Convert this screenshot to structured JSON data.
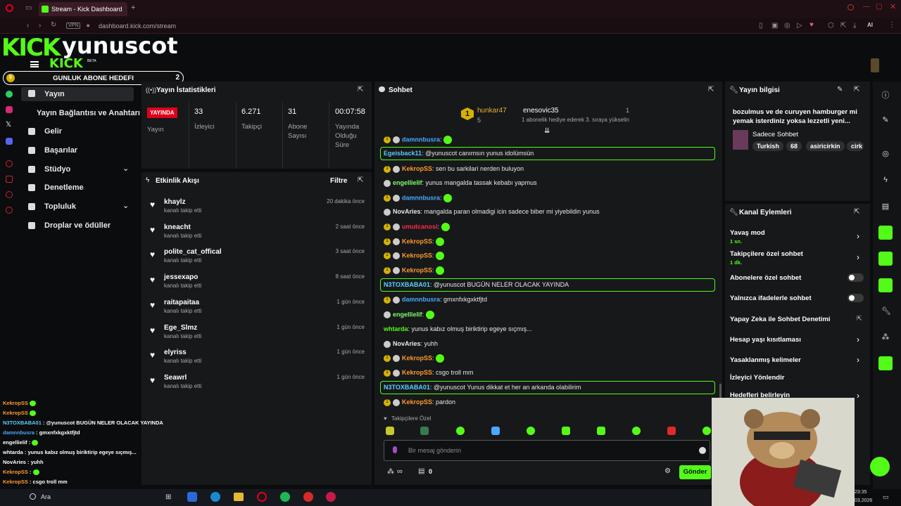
{
  "browser": {
    "tab_title": "Stream - Kick Dashboard",
    "new_tab": "+",
    "url": "dashboard.kick.com/stream",
    "vpn": "VPN",
    "ai": "AI"
  },
  "brand": {
    "logo": "KICK",
    "logo_small": "KICK",
    "beta": "BETA",
    "channel": "yunuscot",
    "goal_label": "GUNLUK ABONE HEDEFI",
    "goal_left": "0",
    "goal_right": "2"
  },
  "sidebar": {
    "items": [
      {
        "label": "Yayın",
        "icon": "video-icon"
      },
      {
        "label": "Yayın Bağlantısı ve Anahtarı",
        "icon": ""
      },
      {
        "label": "Gelir",
        "icon": "dollar-icon"
      },
      {
        "label": "Başarılar",
        "icon": "trophy-icon"
      },
      {
        "label": "Stüdyo",
        "icon": "studio-icon"
      },
      {
        "label": "Denetleme",
        "icon": "wrench-icon"
      },
      {
        "label": "Topluluk",
        "icon": "community-icon"
      },
      {
        "label": "Droplar ve ödüller",
        "icon": "gift-icon"
      }
    ]
  },
  "stats": {
    "title": "Yayın İstatistikleri",
    "live": "YAYINDA",
    "live_label": "Yayın",
    "viewers": "33",
    "viewers_label": "İzleyici",
    "followers": "6.271",
    "followers_label": "Takipçi",
    "subs": "31",
    "subs_label_1": "Abone",
    "subs_label_2": "Sayısı",
    "uptime": "00:07:58",
    "uptime_label_1": "Yayında",
    "uptime_label_2": "Olduğu",
    "uptime_label_3": "Süre"
  },
  "activity": {
    "title": "Etkinlik Akışı",
    "filter": "Filtre",
    "rows": [
      {
        "name": "khaylz",
        "sub": "kanalı takip etti",
        "time": "20 dakika önce"
      },
      {
        "name": "kneacht",
        "sub": "kanalı takip etti",
        "time": "2 saat önce"
      },
      {
        "name": "polite_cat_offical",
        "sub": "kanalı takip etti",
        "time": "3 saat önce"
      },
      {
        "name": "jessexapo",
        "sub": "kanalı takip etti",
        "time": "8 saat önce"
      },
      {
        "name": "raitapaitaa",
        "sub": "kanalı takip etti",
        "time": "1 gün önce"
      },
      {
        "name": "Ege_Slmz",
        "sub": "kanalı takip etti",
        "time": "1 gün önce"
      },
      {
        "name": "elyriss",
        "sub": "kanalı takip etti",
        "time": "1 gün önce"
      },
      {
        "name": "Seawrl",
        "sub": "kanalı takip etti",
        "time": "1 gün önce"
      }
    ]
  },
  "chat": {
    "title": "Sohbet",
    "pinned_user1": "hunkar47",
    "pinned_count1": "5",
    "pinned_rank": "1",
    "pinned_user2": "enesovic35",
    "pinned_count2": "1",
    "pinned_text": "1 abonelik hediye ederek 3. sıraya yükselin",
    "messages": [
      {
        "user": "damnnbusra",
        "text": "",
        "color": "#4aa8ff",
        "boxed": false,
        "badges": 2
      },
      {
        "user": "Egeisback11",
        "text": "@yunuscot canımsın yunus idolümsün",
        "color": "#5cc9ff",
        "boxed": true,
        "badges": 0
      },
      {
        "user": "KekropSS",
        "text": "sen bu sarkilari nerden buluyon",
        "color": "#ff9a2e",
        "boxed": false,
        "badges": 2
      },
      {
        "user": "engellielif",
        "text": "yunus mangalda tassak kebabı yapmus",
        "color": "#7dff6b",
        "boxed": false,
        "badges": 1
      },
      {
        "user": "damnnbusra",
        "text": "",
        "color": "#4aa8ff",
        "boxed": false,
        "badges": 2
      },
      {
        "user": "NovAries",
        "text": "mangalda paran olmadigi icin sadece biber mi yiyebildin yunus",
        "color": "#e8e8e8",
        "boxed": false,
        "badges": 1
      },
      {
        "user": "umutcanosi",
        "text": "",
        "color": "#ff2a4a",
        "boxed": false,
        "badges": 2
      },
      {
        "user": "KekropSS",
        "text": "",
        "color": "#ff9a2e",
        "boxed": false,
        "badges": 2
      },
      {
        "user": "KekropSS",
        "text": "",
        "color": "#ff9a2e",
        "boxed": false,
        "badges": 2
      },
      {
        "user": "KekropSS",
        "text": "",
        "color": "#ff9a2e",
        "boxed": false,
        "badges": 2
      },
      {
        "user": "N3TOXBABA01",
        "text": "@yunuscot BUGÜN NELER OLACAK YAYINDA",
        "color": "#5cd0ff",
        "boxed": true,
        "badges": 0
      },
      {
        "user": "damnnbusra",
        "text": "gmxnfxkgxktfjtd",
        "color": "#4aa8ff",
        "boxed": false,
        "badges": 2
      },
      {
        "user": "engellielif",
        "text": "",
        "color": "#7dff6b",
        "boxed": false,
        "badges": 1
      },
      {
        "user": "whtarda",
        "text": "yunus kabız olmuş biriktirip egeye sıçmış...",
        "color": "#53fc18",
        "boxed": false,
        "badges": 0
      },
      {
        "user": "NovAries",
        "text": "yuhh",
        "color": "#e8e8e8",
        "boxed": false,
        "badges": 1
      },
      {
        "user": "KekropSS",
        "text": "",
        "color": "#ff9a2e",
        "boxed": false,
        "badges": 2
      },
      {
        "user": "KekropSS",
        "text": "csgo troll mm",
        "color": "#ff9a2e",
        "boxed": false,
        "badges": 2
      },
      {
        "user": "N3TOXBABA01",
        "text": "@yunuscot Yunus dikkat et her an arkanda olabilirim",
        "color": "#5cd0ff",
        "boxed": true,
        "badges": 0
      },
      {
        "user": "KekropSS",
        "text": "pardon",
        "color": "#ff9a2e",
        "boxed": false,
        "badges": 2
      }
    ],
    "follower_only": "Takipçilere Özel",
    "input_placeholder": "Bir mesaj gönderin",
    "send": "Gönder",
    "counter": "0"
  },
  "stream_info": {
    "title": "Yayın bilgisi",
    "description": "bozulmus ve de curuyen hamburger mi yemak isterdiniz yoksa lezzetli yeni...",
    "category": "Sadece Sohbet",
    "tags": [
      "Turkish",
      "68",
      "asiricirkin",
      "cirk"
    ]
  },
  "channel_actions": {
    "title": "Kanal Eylemleri",
    "slow_mode": "Yavaş mod",
    "slow_mode_val": "1 sn.",
    "followers_chat": "Takipçilere özel sohbet",
    "followers_chat_val": "1 dk.",
    "subs_chat": "Abonelere özel sohbet",
    "emote_chat": "Yalnızca ifadelerle sohbet",
    "ai_mod": "Yapay Zeka ile Sohbet Denetimi",
    "age_restrict": "Hesap yaşı kısıtlaması",
    "banned_words": "Yasaklanmış kelimeler",
    "raid": "İzleyici Yönlendir",
    "goals": "Hedefleri belirleyin"
  },
  "overlay_chat": [
    {
      "user": "KekropSS",
      "text": ""
    },
    {
      "user": "KekropSS",
      "text": ""
    },
    {
      "user": "N3TOXBABA01",
      "text": ": @yunuscot BUGÜN NELER OLACAK YAYINDA"
    },
    {
      "user": "damnnbusra",
      "text": ": gmxnfxkgxktfjtd"
    },
    {
      "user": "engellielif",
      "text": ":"
    },
    {
      "user": "whtarda",
      "text": ": yunus kabız olmuş biriktirip egeye sıçmış..."
    },
    {
      "user": "NovAries",
      "text": ": yuhh"
    },
    {
      "user": "KekropSS",
      "text": ":"
    },
    {
      "user": "KekropSS",
      "text": ": csgo troll mm"
    },
    {
      "user": "N3TOXBABA01",
      "text": ": @yunuscot Yunus dikkat et her an arkanda olabilirim"
    },
    {
      "user": "KekropSS",
      "text": ": pardon"
    }
  ],
  "taskbar": {
    "search": "Ara",
    "time": "23:35",
    "date": "03.2026"
  },
  "colors": {
    "brand": "#53fc18",
    "live": "#e0001b"
  }
}
